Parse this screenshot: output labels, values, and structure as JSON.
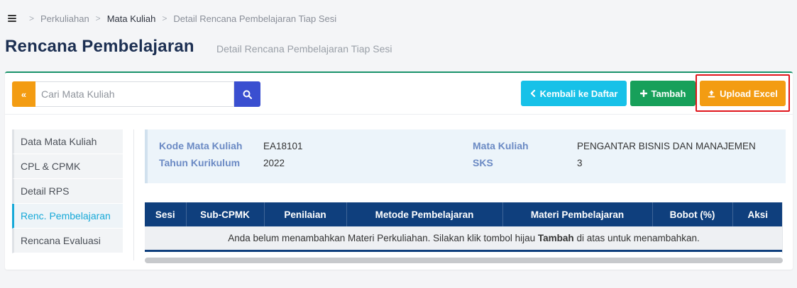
{
  "breadcrumb": {
    "items": [
      "Perkuliahan",
      "Mata Kuliah",
      "Detail Rencana Pembelajaran Tiap Sesi"
    ],
    "separator": ">"
  },
  "page": {
    "title": "Rencana Pembelajaran",
    "subtitle": "Detail Rencana Pembelajaran Tiap Sesi"
  },
  "toolbar": {
    "collapse_label": "«",
    "search_placeholder": "Cari Mata Kuliah",
    "back_label": "Kembali ke Daftar",
    "add_label": "Tambah",
    "upload_label": "Upload Excel"
  },
  "sidebar": {
    "items": [
      {
        "label": "Data Mata Kuliah",
        "active": false
      },
      {
        "label": "CPL & CPMK",
        "active": false
      },
      {
        "label": "Detail RPS",
        "active": false
      },
      {
        "label": "Renc. Pembelajaran",
        "active": true
      },
      {
        "label": "Rencana Evaluasi",
        "active": false
      }
    ]
  },
  "course": {
    "kode_label": "Kode Mata Kuliah",
    "kode_value": "EA18101",
    "tahun_label": "Tahun Kurikulum",
    "tahun_value": "2022",
    "nama_label": "Mata Kuliah",
    "nama_value": "PENGANTAR BISNIS DAN MANAJEMEN",
    "sks_label": "SKS",
    "sks_value": "3"
  },
  "table": {
    "columns": [
      "Sesi",
      "Sub-CPMK",
      "Penilaian",
      "Metode Pembelajaran",
      "Materi Pembelajaran",
      "Bobot (%)",
      "Aksi"
    ],
    "empty_before": "Anda belum menambahkan Materi Perkuliahan. Silakan klik tombol hijau ",
    "empty_bold": "Tambah",
    "empty_after": " di atas untuk menambahkan."
  },
  "colors": {
    "accent_green": "#17a05a",
    "accent_orange": "#f39c12",
    "accent_cyan": "#17c1e8",
    "header_navy": "#0f3f7d",
    "highlight_red": "#e0151b"
  }
}
